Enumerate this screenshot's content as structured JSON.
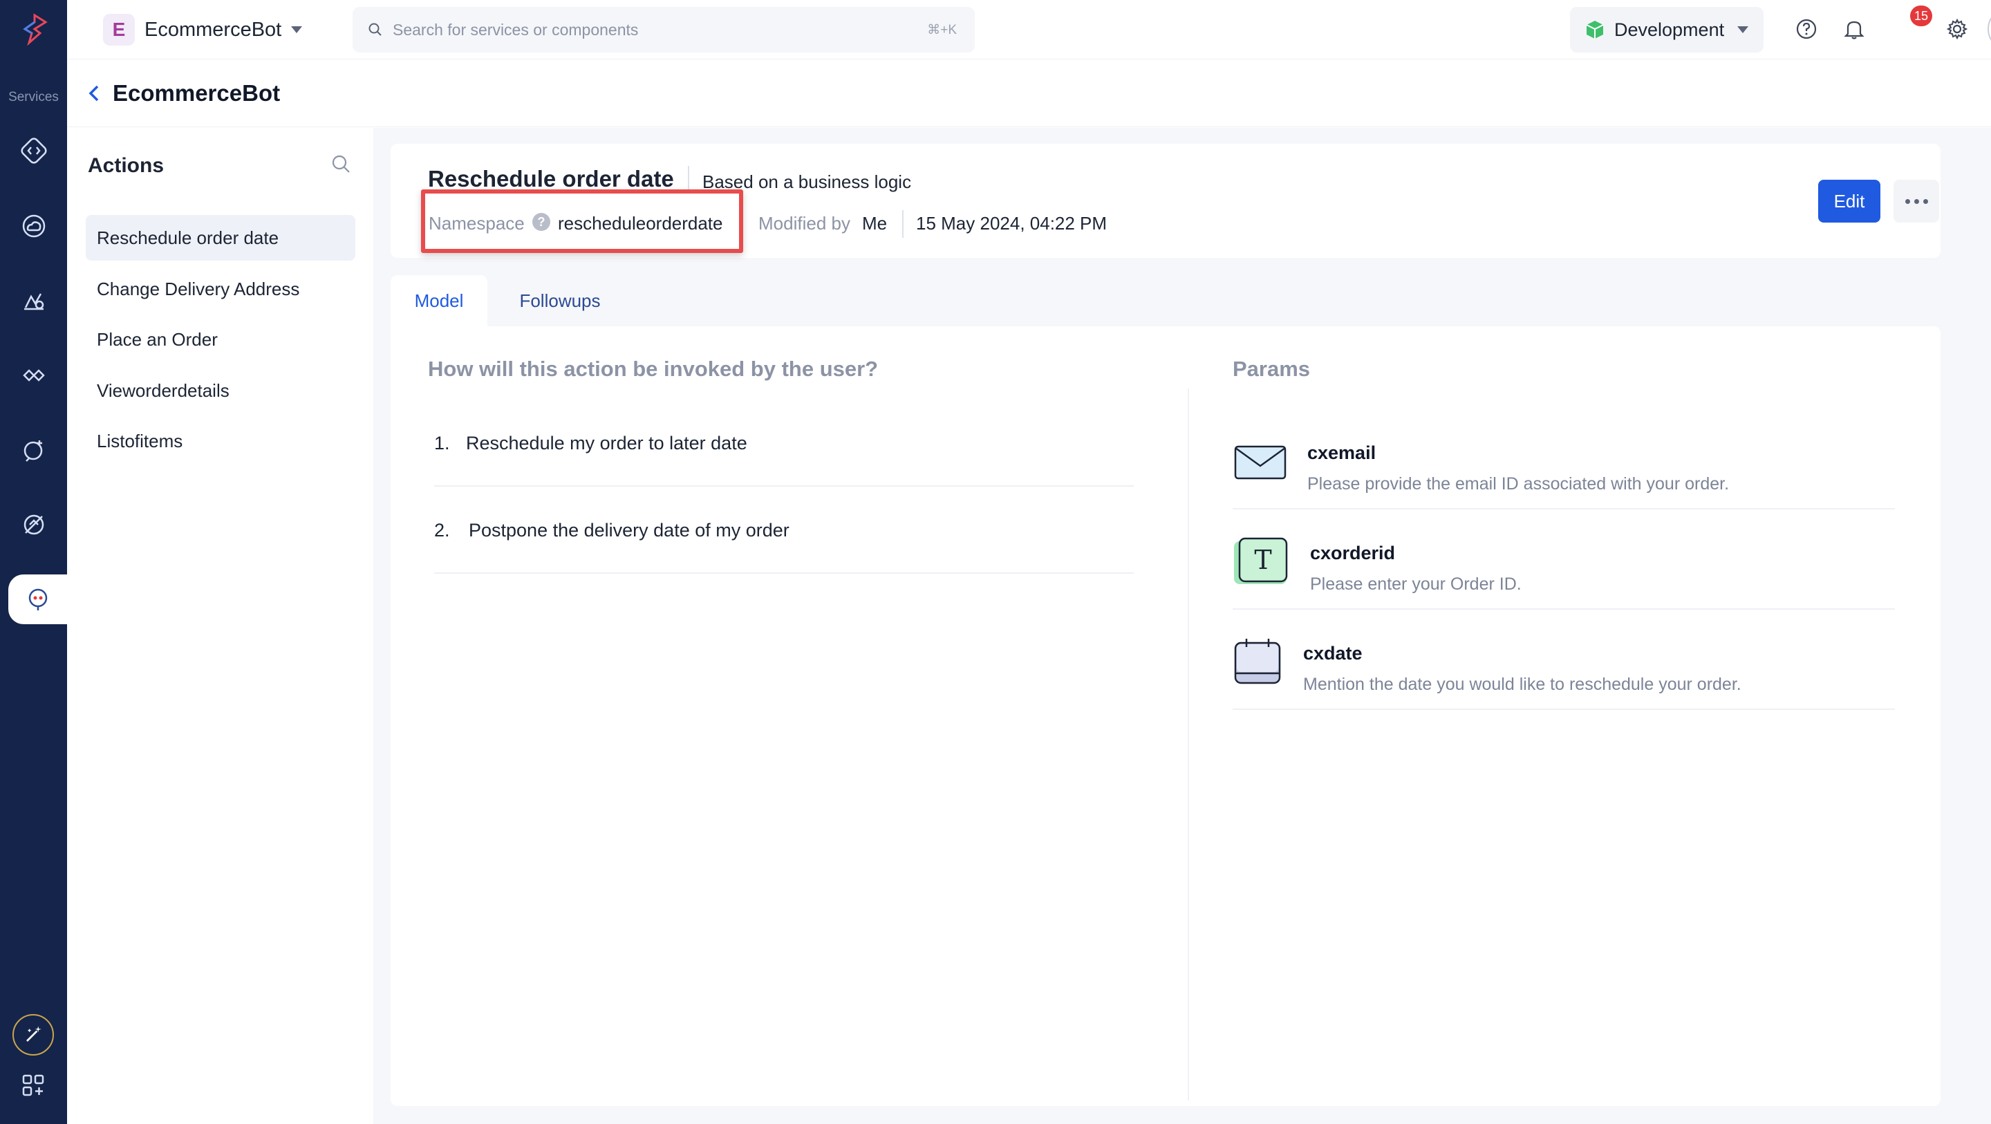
{
  "rail": {
    "services_label": "Services",
    "items": [
      "code-icon",
      "cloud-icon",
      "chart-icon",
      "integration-icon",
      "ai-agent-icon",
      "satellite-icon",
      "chatbot-icon"
    ]
  },
  "topbar": {
    "app_badge": "E",
    "app_name": "EcommerceBot",
    "search_placeholder": "Search for services or components",
    "search_shortcut": "⌘+K",
    "environment": "Development",
    "notification_count": "15"
  },
  "breadcrumb": {
    "title": "EcommerceBot"
  },
  "actions_panel": {
    "title": "Actions",
    "items": [
      "Reschedule order date",
      "Change Delivery Address",
      "Place an Order",
      "Vieworderdetails",
      "Listofitems"
    ],
    "selected_index": 0
  },
  "detail": {
    "title": "Reschedule order date",
    "subtitle": "Based on a business logic",
    "namespace_label": "Namespace",
    "namespace_value": "rescheduleorderdate",
    "modified_label": "Modified by",
    "modified_by": "Me",
    "modified_date": "15 May 2024, 04:22 PM",
    "edit_label": "Edit"
  },
  "tabs": [
    {
      "label": "Model",
      "active": true
    },
    {
      "label": "Followups",
      "active": false
    }
  ],
  "model": {
    "question": "How will this action be invoked by the user?",
    "utterances": [
      {
        "num": "1.",
        "text": "Reschedule my order to later date"
      },
      {
        "num": "2.",
        "text": "Postpone the delivery date of my order"
      }
    ]
  },
  "params": {
    "heading": "Params",
    "items": [
      {
        "name": "cxemail",
        "description": "Please provide the email ID associated with your order.",
        "icon": "email-icon"
      },
      {
        "name": "cxorderid",
        "description": "Please enter your Order ID.",
        "icon": "text-icon"
      },
      {
        "name": "cxdate",
        "description": "Mention the date you would like to reschedule your order.",
        "icon": "calendar-icon"
      }
    ]
  },
  "colors": {
    "rail": "#15244a",
    "accent": "#1f5ae0",
    "highlight_box": "#e84c4c",
    "badge": "#e5383b"
  }
}
